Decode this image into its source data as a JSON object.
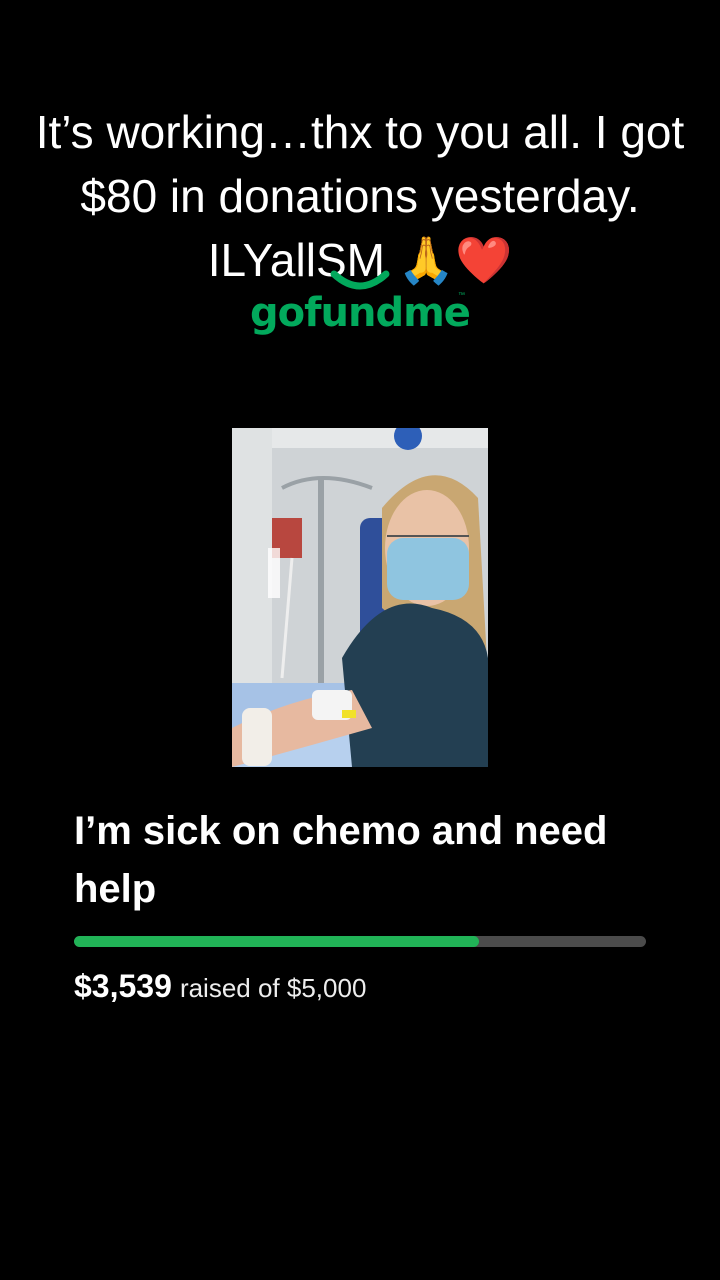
{
  "caption": {
    "text": "It’s working…thx to you all.  I got $80 in donations yesterday. ILYallSM 🙏❤️"
  },
  "logo": {
    "text": "gofundme",
    "tm": "™",
    "color": "#02a95c"
  },
  "campaign": {
    "title": "I’m sick on chemo and need help",
    "raised_amount": "$3,539",
    "goal_text": "raised of $5,000",
    "progress_fraction": 0.7078,
    "progress_color": "#21b357"
  }
}
